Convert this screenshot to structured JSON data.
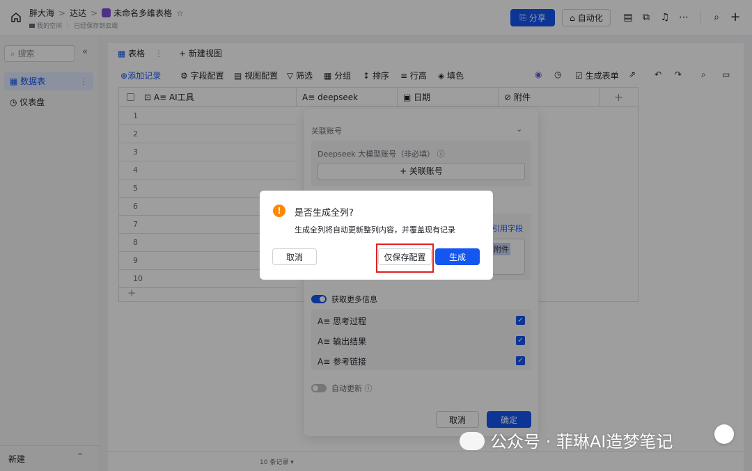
{
  "topbar": {
    "breadcrumb": [
      "胖大海",
      "达达",
      "未命名多维表格"
    ],
    "location": "我的空间",
    "save_status": "已经保存到云端",
    "share_label": "分享",
    "automation_label": "自动化"
  },
  "sidebar": {
    "search_placeholder": "搜索",
    "items": [
      {
        "label": "数据表",
        "active": true
      },
      {
        "label": "仪表盘",
        "active": false
      }
    ],
    "footer_label": "新建"
  },
  "tabs": {
    "table_tab": "表格",
    "new_view": "新建视图"
  },
  "toolbar": {
    "add_record": "添加记录",
    "field_config": "字段配置",
    "view_config": "视图配置",
    "filter": "筛选",
    "group": "分组",
    "sort": "排序",
    "row_height": "行高",
    "fill_color": "填色",
    "generate_form": "生成表单"
  },
  "grid": {
    "columns": [
      "AI工具",
      "deepseek",
      "日期",
      "附件"
    ],
    "row_numbers": [
      "1",
      "2",
      "3",
      "4",
      "5",
      "6",
      "7",
      "8",
      "9",
      "10"
    ],
    "record_count": "10 条记录"
  },
  "panel": {
    "linked_account_title": "关联账号",
    "model_account_label": "Deepseek 大模型账号（非必填）",
    "link_account_button": "+ 关联账号",
    "reference_field": "引用字段",
    "attachment_chip": "附件",
    "more_info_label": "获取更多信息",
    "options": [
      {
        "label": "思考过程",
        "checked": true
      },
      {
        "label": "输出结果",
        "checked": true
      },
      {
        "label": "参考链接",
        "checked": true
      }
    ],
    "auto_update_label": "自动更新",
    "cancel": "取消",
    "confirm": "确定"
  },
  "dialog": {
    "title": "是否生成全列?",
    "description": "生成全列将自动更新整列内容，并覆盖现有记录",
    "cancel": "取消",
    "save_only": "仅保存配置",
    "generate": "生成"
  },
  "watermark": "公众号 · 菲琳AI造梦笔记",
  "colors": {
    "primary": "#1456f0",
    "warning": "#ff8800",
    "highlight": "#e02020"
  }
}
